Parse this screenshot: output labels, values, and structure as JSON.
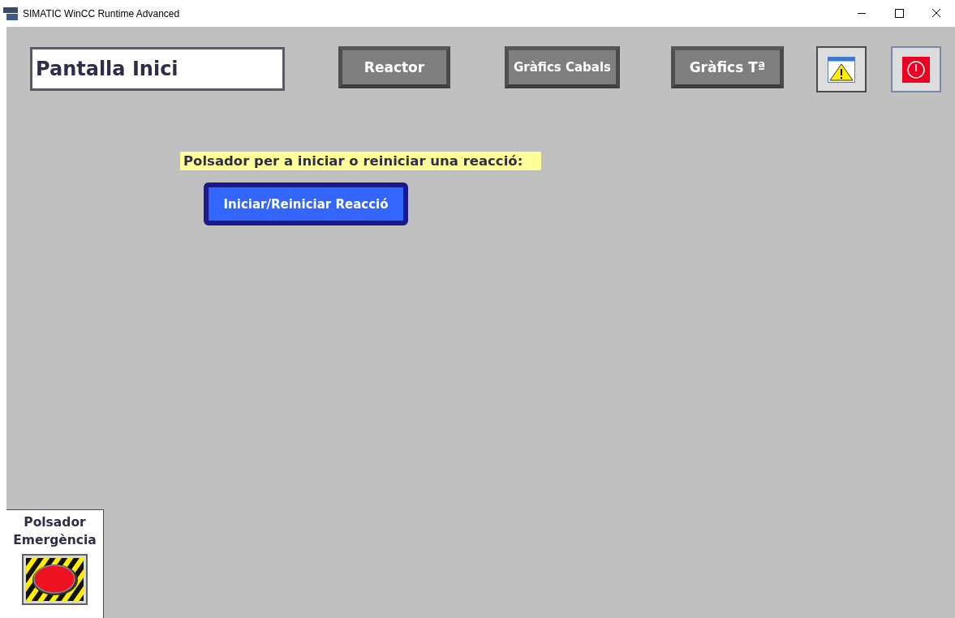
{
  "window": {
    "title": "SIMATIC WinCC Runtime Advanced"
  },
  "screen_title": "Pantalla Inici",
  "nav_buttons": [
    "Reactor",
    "Gràfics Cabals",
    "Gràfics Tª"
  ],
  "prompt_label": "Polsador per a iniciar o reiniciar una reacció:",
  "action_button": "Iniciar/Reiniciar Reacció",
  "emergency_panel": {
    "label_lines": [
      "Polsador",
      "Emergència"
    ]
  }
}
